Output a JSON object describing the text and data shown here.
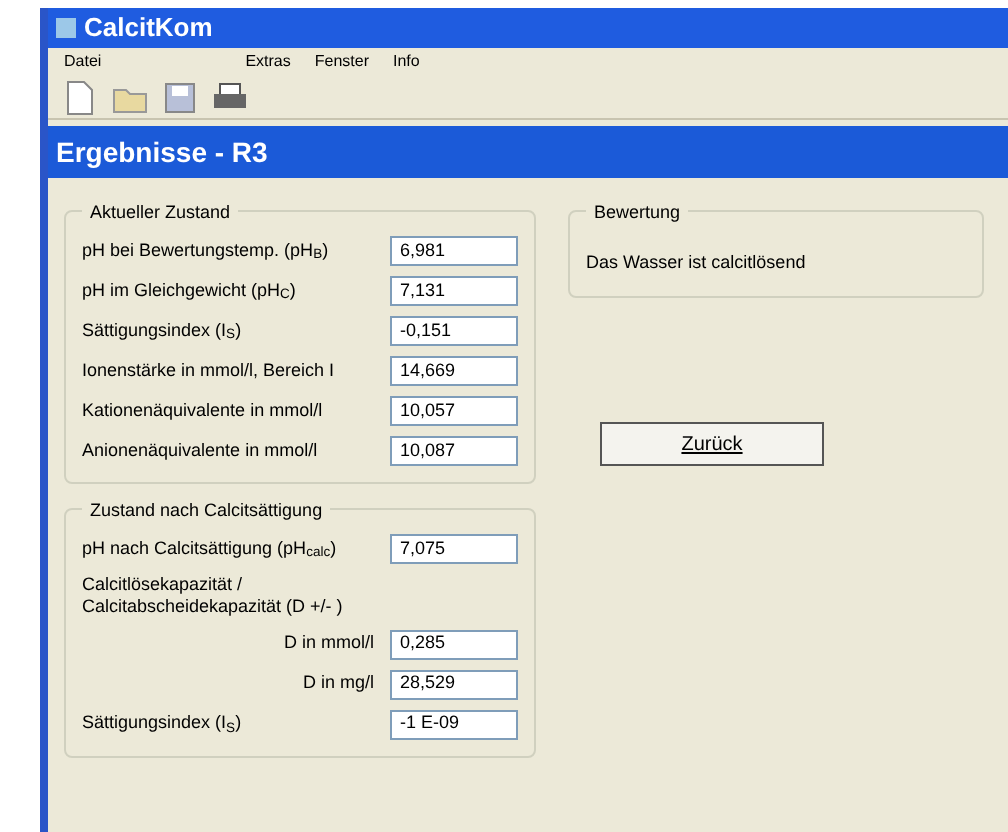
{
  "window": {
    "title": "CalcitKom"
  },
  "menu": [
    {
      "label": "Datei"
    },
    {
      "label": "Extras"
    },
    {
      "label": "Fenster"
    },
    {
      "label": "Info"
    }
  ],
  "toolbar": [
    {
      "kind": "new"
    },
    {
      "kind": "open"
    },
    {
      "kind": "save"
    },
    {
      "kind": "print"
    }
  ],
  "child_window": {
    "title": "Ergebnisse - R3"
  },
  "current_state": {
    "title": "Aktueller Zustand",
    "rows": [
      {
        "label": "pH bei Bewertungstemp. (pH$_{B}$)",
        "value": "6,981"
      },
      {
        "label": "pH im Gleichgewicht (pH$_{C}$)",
        "value": "7,131"
      },
      {
        "label": "Sättigungsindex (I$_{S}$)",
        "value": "-0,151"
      },
      {
        "label": "Ionenstärke in mmol/l, Bereich I",
        "value": "14,669"
      },
      {
        "label": "Kationenäquivalente in mmol/l",
        "value": "10,057"
      },
      {
        "label": "Anionenäquivalente in mmol/l",
        "value": "10,087"
      }
    ]
  },
  "after_saturation": {
    "title": "Zustand nach Calcitsättigung",
    "ph_row": {
      "label": "pH nach Calcitsättigung (pH$_{calc}$)",
      "value": "7,075"
    },
    "capacity_label": "Calcitlösekapazität / Calcitabscheidekapazität (D +/- )",
    "rows": [
      {
        "label": "D in mmol/l",
        "value": "0,285"
      },
      {
        "label": "D in mg/l",
        "value": "28,529"
      }
    ],
    "si_row": {
      "label": "Sättigungsindex (I$_{S}$)",
      "value": "-1 E-09"
    }
  },
  "assessment": {
    "title": "Bewertung",
    "text": "Das Wasser ist calcitlösend"
  },
  "back_button": {
    "label": "Zurück"
  }
}
